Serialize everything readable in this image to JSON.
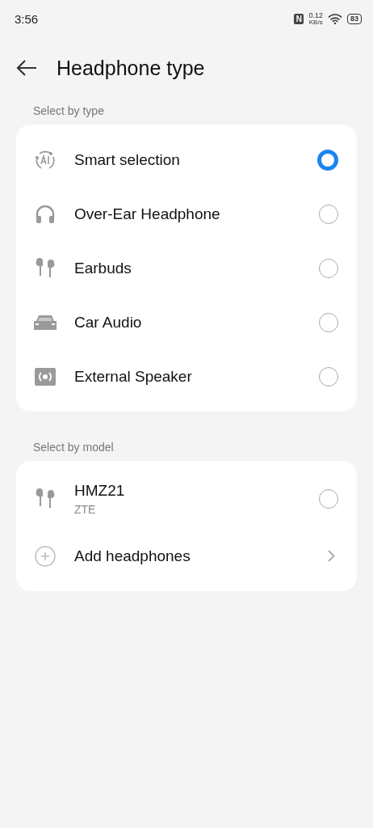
{
  "status_bar": {
    "time": "3:56",
    "nfc": "N",
    "speed_value": "0.12",
    "speed_unit": "KB/s",
    "battery": "83"
  },
  "header": {
    "title": "Headphone type"
  },
  "sections": [
    {
      "label": "Select by type",
      "items": [
        {
          "kind": "ai",
          "label": "Smart selection",
          "selected": true
        },
        {
          "kind": "headphone",
          "label": "Over-Ear Headphone",
          "selected": false
        },
        {
          "kind": "earbuds",
          "label": "Earbuds",
          "selected": false
        },
        {
          "kind": "car",
          "label": "Car Audio",
          "selected": false
        },
        {
          "kind": "speaker",
          "label": "External Speaker",
          "selected": false
        }
      ]
    },
    {
      "label": "Select by model",
      "items": [
        {
          "kind": "earbuds",
          "label": "HMZ21",
          "subtitle": "ZTE",
          "selected": false
        },
        {
          "kind": "add",
          "label": "Add headphones"
        }
      ]
    }
  ]
}
